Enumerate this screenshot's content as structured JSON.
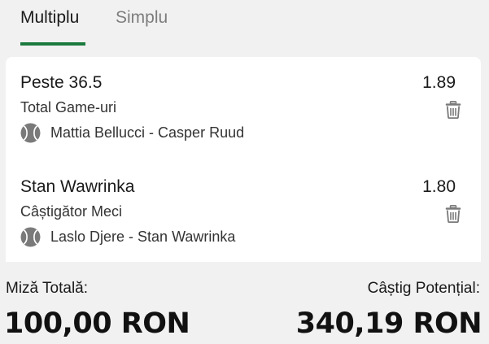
{
  "tabs": [
    {
      "label": "Multiplu",
      "active": true
    },
    {
      "label": "Simplu",
      "active": false
    }
  ],
  "colors": {
    "accent": "#1b7a3e",
    "icon": "#7a7a7a",
    "background": "#f1f1f1",
    "card": "#ffffff"
  },
  "bets": [
    {
      "selection": "Peste 36.5",
      "odds": "1.89",
      "market": "Total Game-uri",
      "event": "Mattia Bellucci - Casper Ruud",
      "sport_icon": "tennis-ball-icon",
      "delete_icon": "trash-icon"
    },
    {
      "selection": "Stan Wawrinka",
      "odds": "1.80",
      "market": "Câștigător Meci",
      "event": "Laslo Djere - Stan Wawrinka",
      "sport_icon": "tennis-ball-icon",
      "delete_icon": "trash-icon"
    }
  ],
  "summary": {
    "stake_label": "Miză Totală:",
    "stake_value": "100,00 RON",
    "win_label": "Câștig Potențial:",
    "win_value": "340,19 RON"
  }
}
